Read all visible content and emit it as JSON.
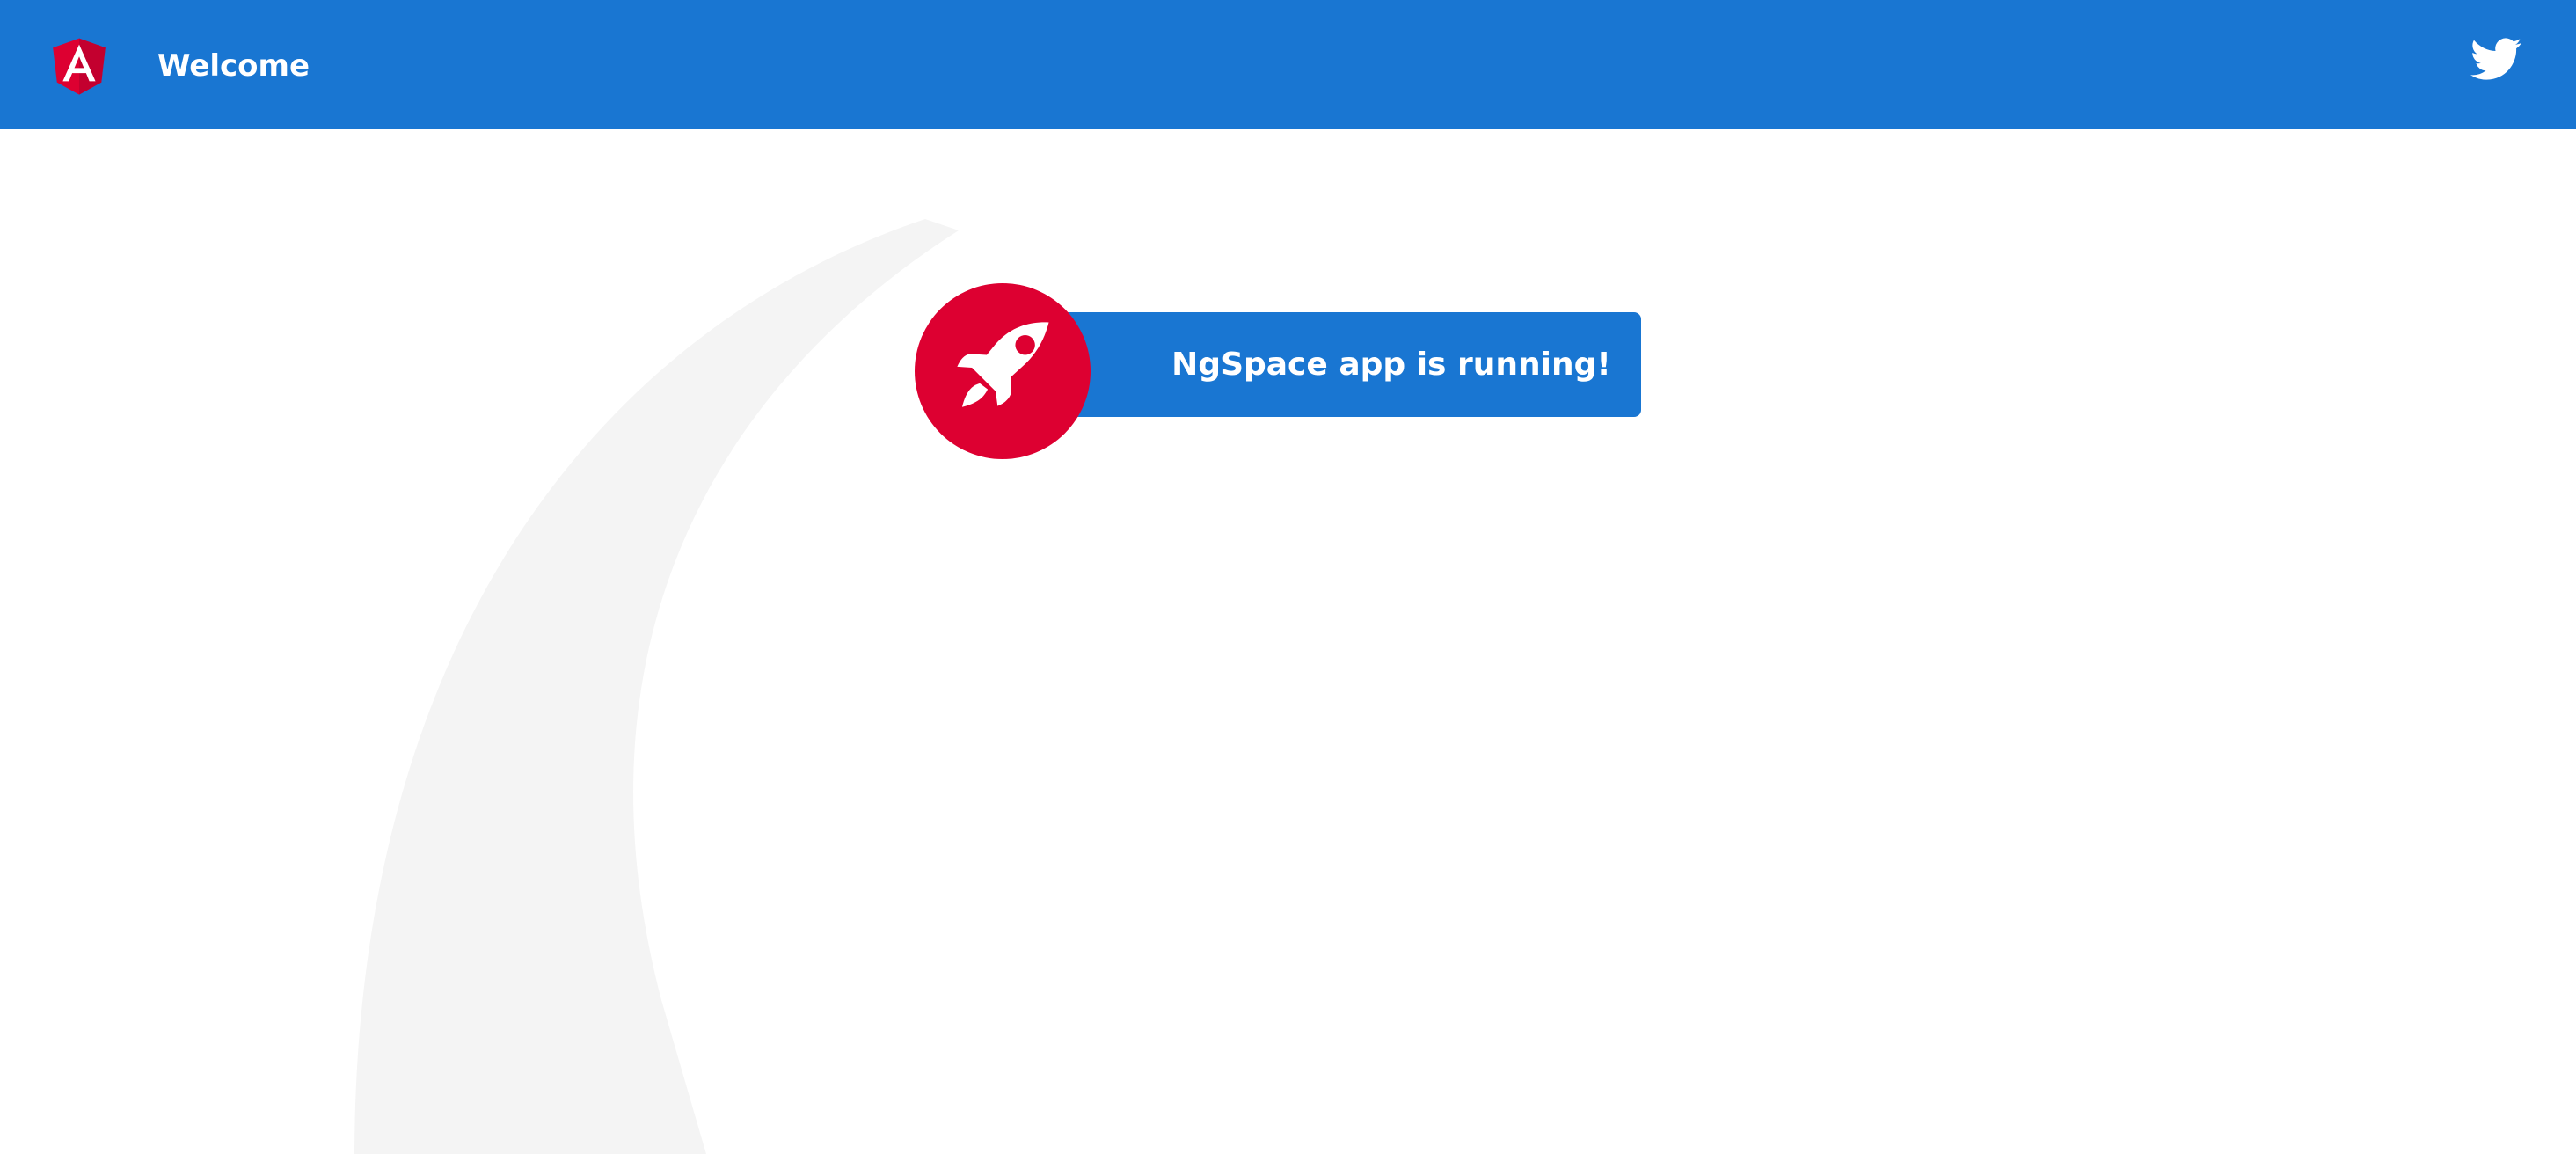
{
  "toolbar": {
    "logo_icon": "angular-logo-icon",
    "title": "Welcome",
    "twitter_icon": "twitter-icon",
    "background_color": "#1976d2"
  },
  "banner": {
    "icon": "rocket-icon",
    "text": "NgSpace app is running!",
    "background_color": "#1976d2",
    "icon_background_color": "#dd0031"
  }
}
